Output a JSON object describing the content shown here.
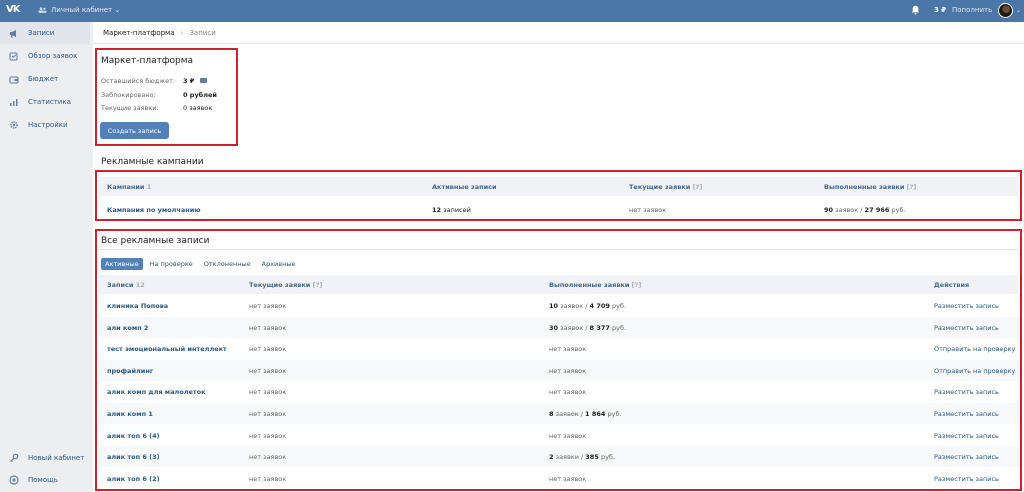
{
  "topbar": {
    "logo": "VK",
    "cabinet": "Личный кабинет",
    "balance": "3 ₽",
    "topup": "Пополнить"
  },
  "sidebar": {
    "items": [
      {
        "label": "Записи",
        "icon": "megaphone-icon",
        "active": true
      },
      {
        "label": "Обзор заявок",
        "icon": "review-icon"
      },
      {
        "label": "Бюджет",
        "icon": "wallet-icon"
      },
      {
        "label": "Статистика",
        "icon": "stats-icon"
      },
      {
        "label": "Настройки",
        "icon": "gear-icon"
      }
    ],
    "bottom": [
      {
        "label": "Новый кабинет",
        "icon": "key-icon"
      },
      {
        "label": "Помощь",
        "icon": "help-icon"
      }
    ]
  },
  "breadcrumb": {
    "root": "Маркет-платформа",
    "current": "Записи"
  },
  "platform": {
    "title": "Маркет-платформа",
    "budget_label": "Оставшийся бюджет:",
    "budget_value": "3 ₽",
    "blocked_label": "Заблокировано:",
    "blocked_value": "0 рублей",
    "current_label": "Текущие заявки:",
    "current_value": "0 заявок",
    "create_button": "Создать запись"
  },
  "campaigns": {
    "title": "Рекламные кампании",
    "headers": {
      "name": "Кампании",
      "count": "1",
      "active": "Активные записи",
      "current": "Текущие заявки",
      "current_q": "[?]",
      "done": "Выполненные заявки",
      "done_q": "[?]"
    },
    "row": {
      "name": "Кампания по умолчанию",
      "active_n": "12",
      "active_t": "записей",
      "current": "нет заявок",
      "done_n": "90",
      "done_mid": "заявок /",
      "done_sum": "27 966",
      "done_cur": "руб."
    }
  },
  "records": {
    "title": "Все рекламные записи",
    "tabs": [
      "Активные",
      "На проверке",
      "Отклоненные",
      "Архивные"
    ],
    "headers": {
      "name": "Записи",
      "count": "12",
      "current": "Текущие заявки",
      "current_q": "[?]",
      "done": "Выполненные заявки",
      "done_q": "[?]",
      "actions": "Действия"
    },
    "rows": [
      {
        "name": "клиника Попова",
        "current": "нет заявок",
        "done_n": "10",
        "done_mid": "заявок /",
        "done_sum": "4 709",
        "done_cur": "руб.",
        "action": "Разместить запись"
      },
      {
        "name": "али комп 2",
        "current": "нет заявок",
        "done_n": "30",
        "done_mid": "заявок /",
        "done_sum": "8 377",
        "done_cur": "руб.",
        "action": "Разместить запись"
      },
      {
        "name": "тест эмоциональный интеллект",
        "current": "нет заявок",
        "done_text": "нет заявок",
        "action": "Отправить на проверку"
      },
      {
        "name": "профайлинг",
        "current": "нет заявок",
        "done_text": "нет заявок",
        "action": "Отправить на проверку"
      },
      {
        "name": "алик комп для малолеток",
        "current": "нет заявок",
        "done_text": "нет заявок",
        "action": "Разместить запись"
      },
      {
        "name": "алик комп 1",
        "current": "нет заявок",
        "done_n": "8",
        "done_mid": "заявок /",
        "done_sum": "1 864",
        "done_cur": "руб.",
        "action": "Разместить запись"
      },
      {
        "name": "алик топ 6 (4)",
        "current": "нет заявок",
        "done_text": "нет заявок",
        "action": "Разместить запись"
      },
      {
        "name": "алик топ 6 (3)",
        "current": "нет заявок",
        "done_n": "2",
        "done_mid": "заявки /",
        "done_sum": "385",
        "done_cur": "руб.",
        "action": "Разместить запись"
      },
      {
        "name": "алик топ 6 (2)",
        "current": "нет заявок",
        "done_text": "нет заявок",
        "action": "Разместить запись"
      }
    ]
  }
}
